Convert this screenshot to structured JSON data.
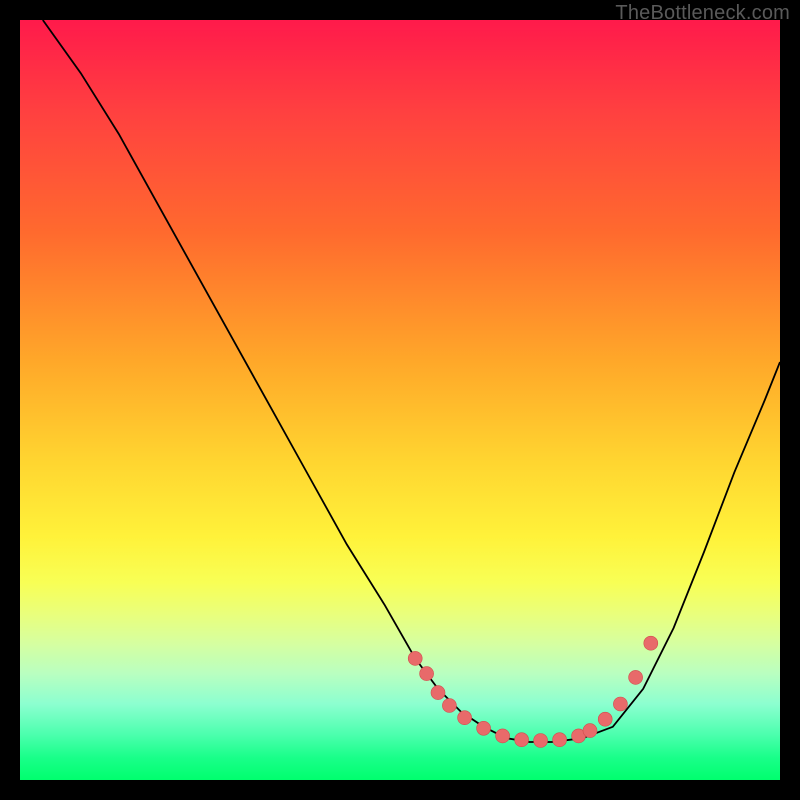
{
  "watermark": "TheBottleneck.com",
  "colors": {
    "curve_stroke": "#000000",
    "marker_fill": "#e86a6a",
    "marker_stroke": "#d24d4d"
  },
  "chart_data": {
    "type": "line",
    "title": "",
    "xlabel": "",
    "ylabel": "",
    "xlim": [
      0,
      100
    ],
    "ylim": [
      0,
      100
    ],
    "curve": {
      "x": [
        3,
        8,
        13,
        18,
        23,
        28,
        33,
        38,
        43,
        48,
        52,
        55,
        58,
        61,
        64,
        67,
        70,
        74,
        78,
        82,
        86,
        90,
        94,
        98,
        100
      ],
      "y": [
        100,
        93,
        85,
        76,
        67,
        58,
        49,
        40,
        31,
        23,
        16,
        12,
        9,
        7,
        5.5,
        5,
        5,
        5.5,
        7,
        12,
        20,
        30,
        40.5,
        50,
        55
      ]
    },
    "markers": {
      "x": [
        52,
        53.5,
        55,
        56.5,
        58.5,
        61,
        63.5,
        66,
        68.5,
        71,
        73.5,
        75,
        77,
        79,
        81,
        83
      ],
      "y": [
        16,
        14,
        11.5,
        9.8,
        8.2,
        6.8,
        5.8,
        5.3,
        5.2,
        5.3,
        5.8,
        6.5,
        8,
        10,
        13.5,
        18
      ]
    }
  }
}
